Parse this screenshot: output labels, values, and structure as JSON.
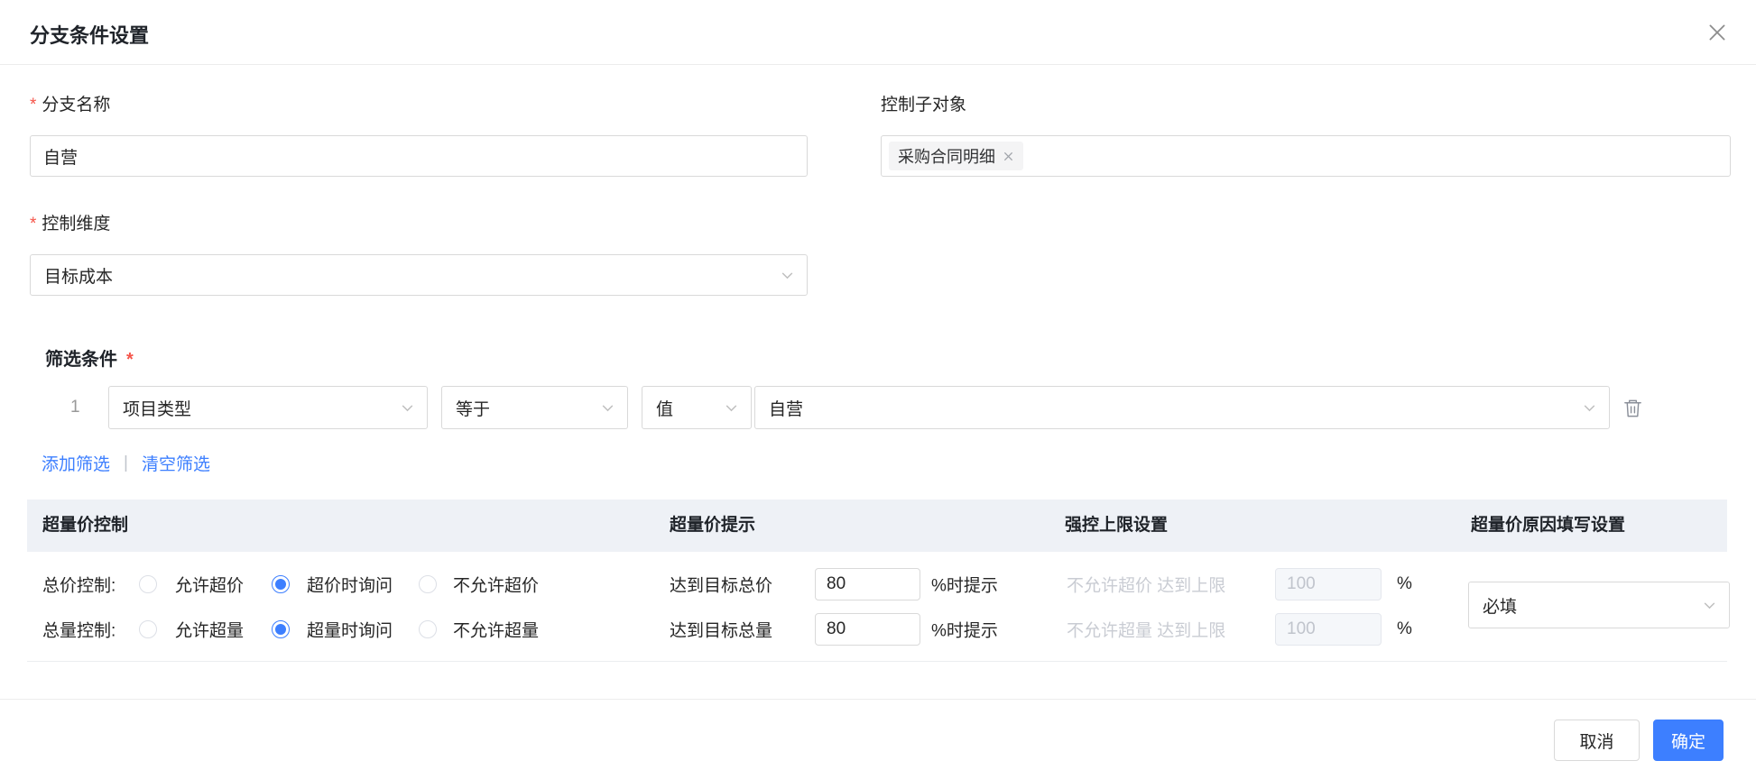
{
  "dialog": {
    "title": "分支条件设置"
  },
  "form": {
    "branch_name": {
      "required_mark": "*",
      "label": "分支名称",
      "value": "自营"
    },
    "control_sub_object": {
      "label": "控制子对象",
      "tag_label": "采购合同明细"
    },
    "control_dimension": {
      "required_mark": "*",
      "label": "控制维度",
      "value": "目标成本"
    },
    "filter": {
      "label": "筛选条件",
      "required_mark": "*",
      "row": {
        "index": "1",
        "field": "项目类型",
        "operator": "等于",
        "value_type": "值",
        "value": "自营"
      },
      "add_label": "添加筛选",
      "separator": "|",
      "clear_label": "清空筛选"
    }
  },
  "table": {
    "headers": {
      "control": "超量价控制",
      "hint": "超量价提示",
      "limit": "强控上限设置",
      "reason": "超量价原因填写设置"
    },
    "rows": [
      {
        "control_label": "总价控制:",
        "options": [
          "允许超价",
          "超价时询问",
          "不允许超价"
        ],
        "selected_index": 1,
        "hint_label": "达到目标总价",
        "hint_value": "80",
        "hint_suffix": "%时提示",
        "limit_label": "不允许超价 达到上限",
        "limit_value": "100",
        "limit_suffix": "%"
      },
      {
        "control_label": "总量控制:",
        "options": [
          "允许超量",
          "超量时询问",
          "不允许超量"
        ],
        "selected_index": 1,
        "hint_label": "达到目标总量",
        "hint_value": "80",
        "hint_suffix": "%时提示",
        "limit_label": "不允许超量 达到上限",
        "limit_value": "100",
        "limit_suffix": "%"
      }
    ],
    "reason_select": {
      "value": "必填"
    }
  },
  "footer": {
    "cancel_label": "取消",
    "confirm_label": "确定"
  },
  "colors": {
    "accent": "#3d7fff",
    "link": "#3d7fff",
    "danger": "#f5554a",
    "table_header_bg": "#eef1f6",
    "disabled_text": "#c9ccd3",
    "border": "#d9d9d9"
  }
}
